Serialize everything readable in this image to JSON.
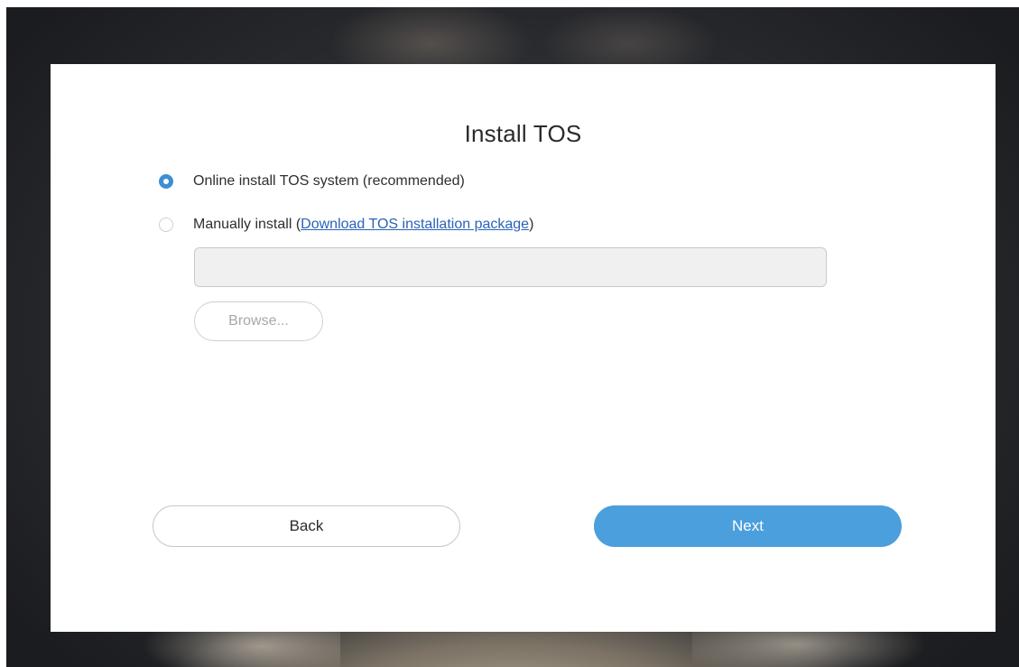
{
  "dialog": {
    "title": "Install TOS",
    "options": {
      "online": {
        "label": "Online install TOS system (recommended)",
        "selected": true
      },
      "manual": {
        "label_prefix": "Manually install (",
        "link_text": "Download TOS installation package",
        "label_suffix": ")",
        "selected": false
      }
    },
    "file_path": {
      "value": "",
      "placeholder": ""
    },
    "browse_label": "Browse...",
    "back_label": "Back",
    "next_label": "Next"
  },
  "colors": {
    "accent": "#4b9fdc",
    "radio_checked": "#3d8fd4",
    "link": "#2a63b8"
  }
}
